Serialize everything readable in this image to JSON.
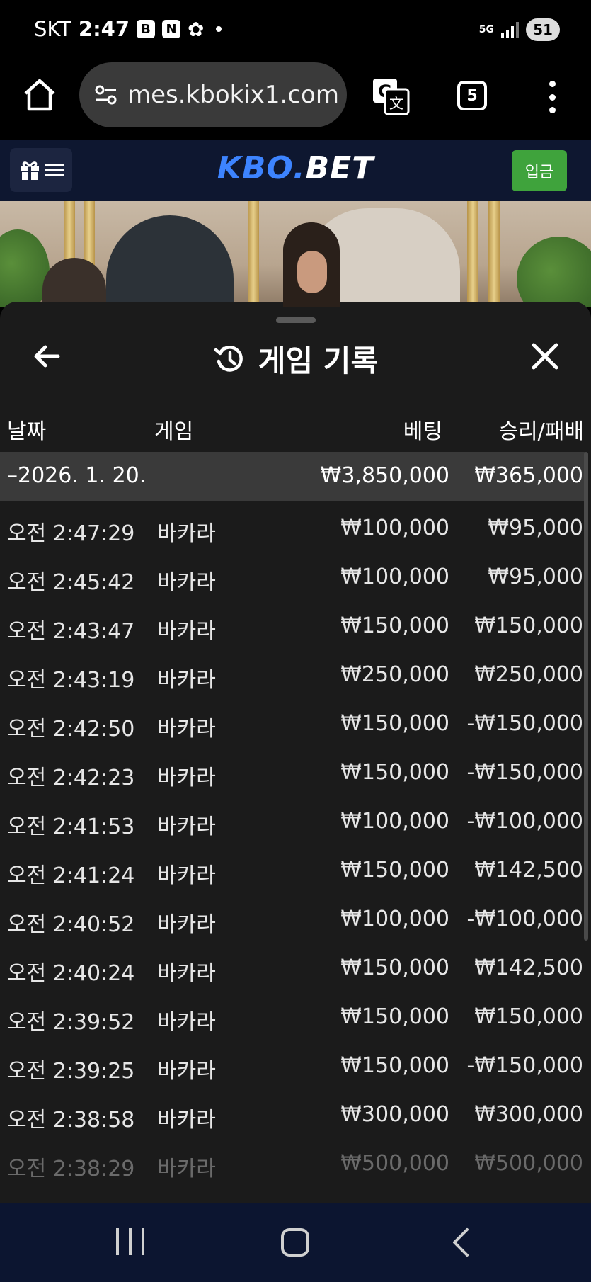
{
  "status_bar": {
    "carrier": "SKT",
    "time": "2:47",
    "app_icons": [
      "B",
      "N",
      "✿"
    ],
    "network": "5G",
    "battery": "51"
  },
  "browser": {
    "url": "mes.kbokix1.com",
    "tab_count": "5"
  },
  "site_header": {
    "logo_part1": "KBO.",
    "logo_part2": "BET",
    "deposit_label": "입금"
  },
  "panel": {
    "title": "게임 기록",
    "columns": {
      "date": "날짜",
      "game": "게임",
      "bet": "베팅",
      "result": "승리/패배"
    },
    "summary": {
      "date": "–2026. 1. 20.",
      "bet": "₩3,850,000",
      "result": "₩365,000"
    },
    "rows": [
      {
        "time": "오전 2:47:29",
        "game": "바카라",
        "bet": "₩100,000",
        "result": "₩95,000"
      },
      {
        "time": "오전 2:45:42",
        "game": "바카라",
        "bet": "₩100,000",
        "result": "₩95,000"
      },
      {
        "time": "오전 2:43:47",
        "game": "바카라",
        "bet": "₩150,000",
        "result": "₩150,000"
      },
      {
        "time": "오전 2:43:19",
        "game": "바카라",
        "bet": "₩250,000",
        "result": "₩250,000"
      },
      {
        "time": "오전 2:42:50",
        "game": "바카라",
        "bet": "₩150,000",
        "result": "-₩150,000"
      },
      {
        "time": "오전 2:42:23",
        "game": "바카라",
        "bet": "₩150,000",
        "result": "-₩150,000"
      },
      {
        "time": "오전 2:41:53",
        "game": "바카라",
        "bet": "₩100,000",
        "result": "-₩100,000"
      },
      {
        "time": "오전 2:41:24",
        "game": "바카라",
        "bet": "₩150,000",
        "result": "₩142,500"
      },
      {
        "time": "오전 2:40:52",
        "game": "바카라",
        "bet": "₩100,000",
        "result": "-₩100,000"
      },
      {
        "time": "오전 2:40:24",
        "game": "바카라",
        "bet": "₩150,000",
        "result": "₩142,500"
      },
      {
        "time": "오전 2:39:52",
        "game": "바카라",
        "bet": "₩150,000",
        "result": "₩150,000"
      },
      {
        "time": "오전 2:39:25",
        "game": "바카라",
        "bet": "₩150,000",
        "result": "-₩150,000"
      },
      {
        "time": "오전 2:38:58",
        "game": "바카라",
        "bet": "₩300,000",
        "result": "₩300,000"
      },
      {
        "time": "오전 2:38:29",
        "game": "바카라",
        "bet": "₩500,000",
        "result": "₩500,000"
      }
    ]
  },
  "icons": {
    "home": "home-icon",
    "site_settings": "tune-icon",
    "translate": "translate-icon",
    "menu": "more-vert-icon",
    "gift": "gift-icon",
    "hamburger": "hamburger-icon",
    "back": "arrow-left-icon",
    "history": "history-icon",
    "close": "close-icon"
  },
  "colors": {
    "logo_blue": "#3d84ff",
    "deposit_green": "#3fa33c",
    "panel_bg": "#1b1b1b",
    "summary_bg": "#3a3a3a",
    "header_bg": "#0e1730"
  }
}
